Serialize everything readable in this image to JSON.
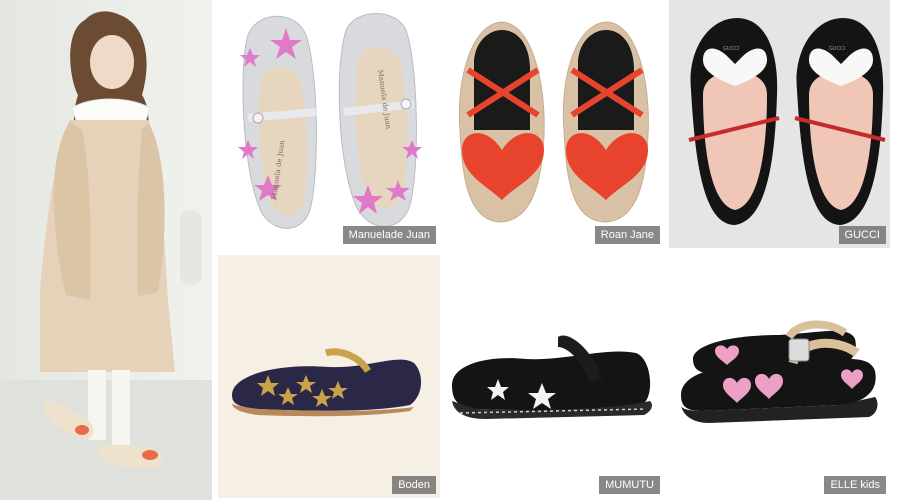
{
  "brands": {
    "manuela": "Manuelade Juan",
    "roan": "Roan Jane",
    "gucci": "GUCCI",
    "boden": "Boden",
    "mumutu": "MUMUTU",
    "elle": "ELLE kids"
  },
  "insole_script": "Manuela de Juan",
  "gucci_insole": "GUCCI",
  "colors": {
    "photo_bg": "#e9ebe6",
    "dress": "#e6d2b8",
    "manuela_leather": "#d8dade",
    "manuela_star": "#e07ac8",
    "roan_strap": "#e8432c",
    "roan_body": "#d9c1a6",
    "gucci_bg": "#e5e5e5",
    "gucci_red_strap": "#c62a2a",
    "boden_velvet": "#2b2746",
    "boden_gold": "#c9a24c",
    "patent_black": "#141414",
    "elle_heart": "#eba0c4",
    "label_bg": "#6e6e6e"
  }
}
